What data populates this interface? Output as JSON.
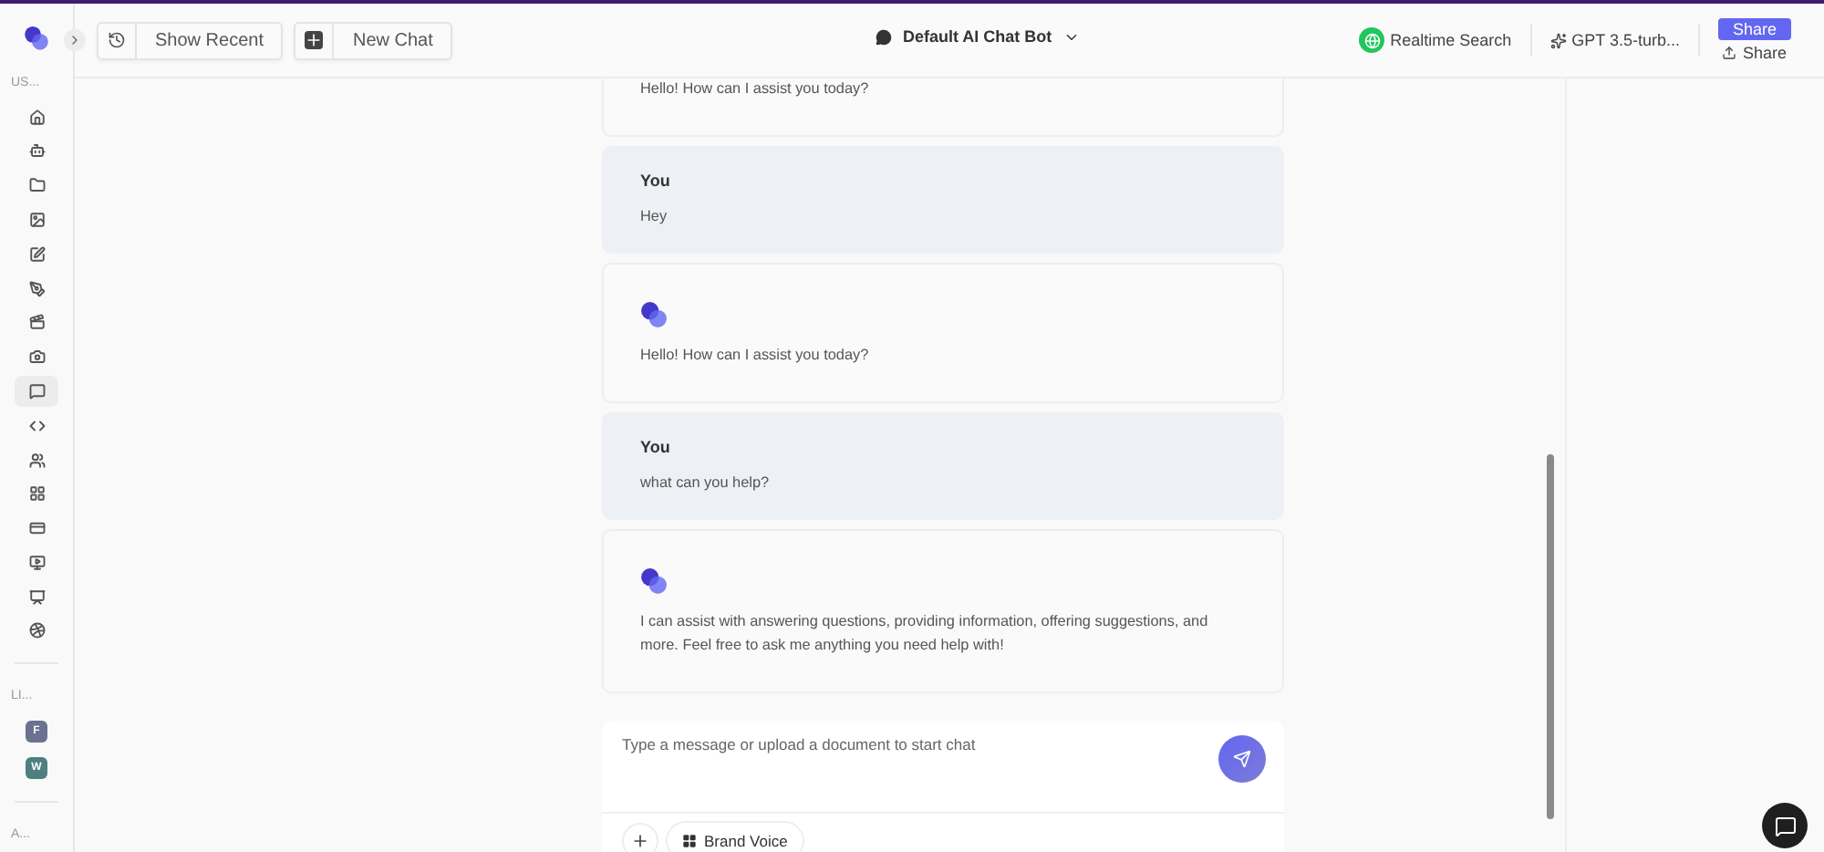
{
  "sidebar": {
    "sections": [
      {
        "label": "US...",
        "items": [
          {
            "selected": false
          },
          {
            "selected": false
          },
          {
            "selected": false
          },
          {
            "selected": false
          },
          {
            "selected": false
          },
          {
            "selected": false
          },
          {
            "selected": false
          },
          {
            "selected": false
          },
          {
            "selected": true
          },
          {
            "selected": false
          },
          {
            "selected": false
          },
          {
            "selected": false
          },
          {
            "selected": false
          },
          {
            "selected": false
          },
          {
            "selected": false
          },
          {
            "selected": false
          }
        ]
      },
      {
        "label": "LI...",
        "workspaces": [
          {
            "letter": "F",
            "color": "#6b7290"
          },
          {
            "letter": "W",
            "color": "#4f7f80"
          }
        ]
      },
      {
        "label": "A..."
      }
    ]
  },
  "header": {
    "buttons": [
      "Show Recent",
      "New Chat"
    ],
    "bot": "Default AI Chat Bot",
    "realtime": "Realtime Search",
    "model": "GPT 3.5-turb...",
    "share_button": "Share",
    "share_link": "Share"
  },
  "messages": [
    {
      "kind": "bot",
      "text": "Hello! How can I assist you today?"
    },
    {
      "kind": "user",
      "author": "You",
      "text": "Hey"
    },
    {
      "kind": "bot",
      "text": "Hello! How can I assist you today?"
    },
    {
      "kind": "user",
      "author": "You",
      "text": "what can you help?"
    },
    {
      "kind": "bot",
      "text": "I can assist with answering questions, providing information, offering suggestions, and more. Feel free to ask me anything you need help with!"
    }
  ],
  "composer": {
    "placeholder": "Type a message or upload a document to start chat",
    "brand_voice": "Brand Voice"
  }
}
